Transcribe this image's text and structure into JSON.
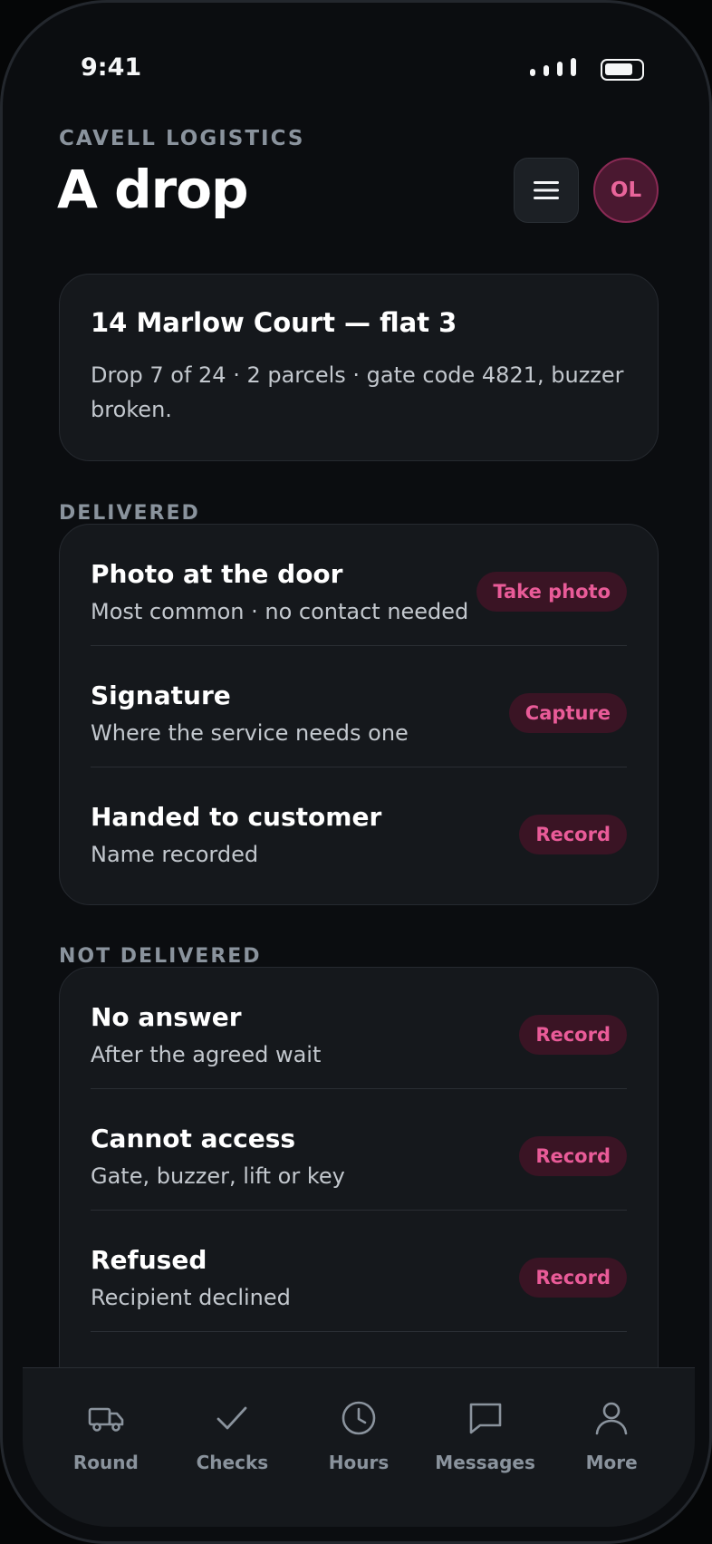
{
  "status_bar": {
    "time": "9:41"
  },
  "header": {
    "company": "CAVELL LOGISTICS",
    "title": "A drop",
    "avatar_initials": "OL"
  },
  "colors": {
    "accent": "#e95b98",
    "accent_bg": "#3a1424",
    "card_bg": "#15181c",
    "muted": "#8a939d"
  },
  "drop_info": {
    "address": "14 Marlow Court — flat 3",
    "details": "Drop 7 of 24 · 2 parcels · gate code 4821, buzzer broken."
  },
  "sections": [
    {
      "label": "DELIVERED",
      "items": [
        {
          "title": "Photo at the door",
          "subtitle": "Most common · no contact needed",
          "action": "Take photo"
        },
        {
          "title": "Signature",
          "subtitle": "Where the service needs one",
          "action": "Capture"
        },
        {
          "title": "Handed to customer",
          "subtitle": "Name recorded",
          "action": "Record"
        }
      ]
    },
    {
      "label": "NOT DELIVERED",
      "items": [
        {
          "title": "No answer",
          "subtitle": "After the agreed wait",
          "action": "Record"
        },
        {
          "title": "Cannot access",
          "subtitle": "Gate, buzzer, lift or key",
          "action": "Record"
        },
        {
          "title": "Refused",
          "subtitle": "Recipient declined",
          "action": "Record"
        }
      ]
    }
  ],
  "tab_bar": [
    {
      "label": "Round",
      "icon": "truck-icon"
    },
    {
      "label": "Checks",
      "icon": "check-icon"
    },
    {
      "label": "Hours",
      "icon": "clock-icon"
    },
    {
      "label": "Messages",
      "icon": "message-icon"
    },
    {
      "label": "More",
      "icon": "person-icon"
    }
  ]
}
